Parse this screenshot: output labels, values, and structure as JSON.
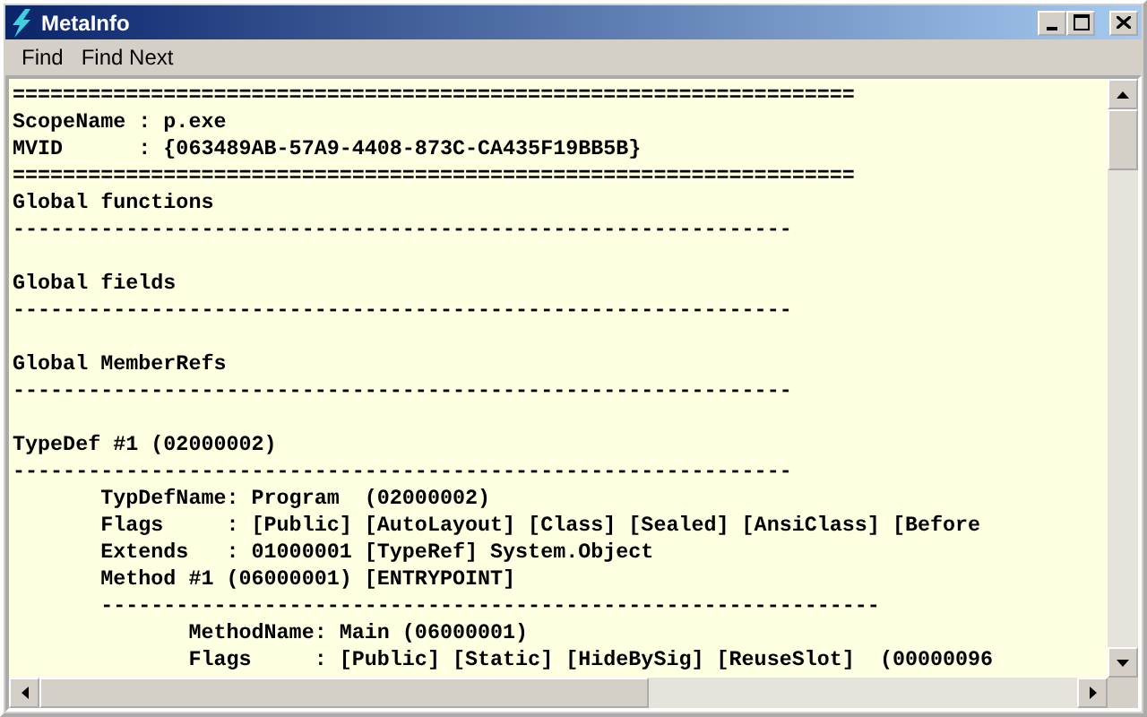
{
  "window": {
    "title": "MetaInfo"
  },
  "menu": [
    {
      "label": "Find"
    },
    {
      "label": "Find Next"
    }
  ],
  "lines": [
    {
      "kind": "text",
      "text": "==================================================================="
    },
    {
      "kind": "text",
      "text": "ScopeName : p.exe"
    },
    {
      "kind": "text",
      "text": "MVID      : {063489AB-57A9-4408-873C-CA435F19BB5B}"
    },
    {
      "kind": "text",
      "text": "==================================================================="
    },
    {
      "kind": "text",
      "text": "Global functions"
    },
    {
      "kind": "text",
      "text": "--------------------------------------------------------------"
    },
    {
      "kind": "blank"
    },
    {
      "kind": "text",
      "text": "Global fields"
    },
    {
      "kind": "text",
      "text": "--------------------------------------------------------------"
    },
    {
      "kind": "blank"
    },
    {
      "kind": "text",
      "text": "Global MemberRefs"
    },
    {
      "kind": "text",
      "text": "--------------------------------------------------------------"
    },
    {
      "kind": "blank"
    },
    {
      "kind": "text",
      "text": "TypeDef #1 (02000002)"
    },
    {
      "kind": "text",
      "text": "--------------------------------------------------------------"
    },
    {
      "kind": "text",
      "text": "       TypDefName: Program  (02000002)"
    },
    {
      "kind": "text",
      "text": "       Flags     : [Public] [AutoLayout] [Class] [Sealed] [AnsiClass] [Before"
    },
    {
      "kind": "text",
      "text": "       Extends   : 01000001 [TypeRef] System.Object"
    },
    {
      "kind": "text",
      "text": "       Method #1 (06000001) [ENTRYPOINT]"
    },
    {
      "kind": "text",
      "text": "       --------------------------------------------------------------"
    },
    {
      "kind": "text",
      "text": "              MethodName: Main (06000001)"
    },
    {
      "kind": "text",
      "text": "              Flags     : [Public] [Static] [HideBySig] [ReuseSlot]  (00000096"
    }
  ]
}
